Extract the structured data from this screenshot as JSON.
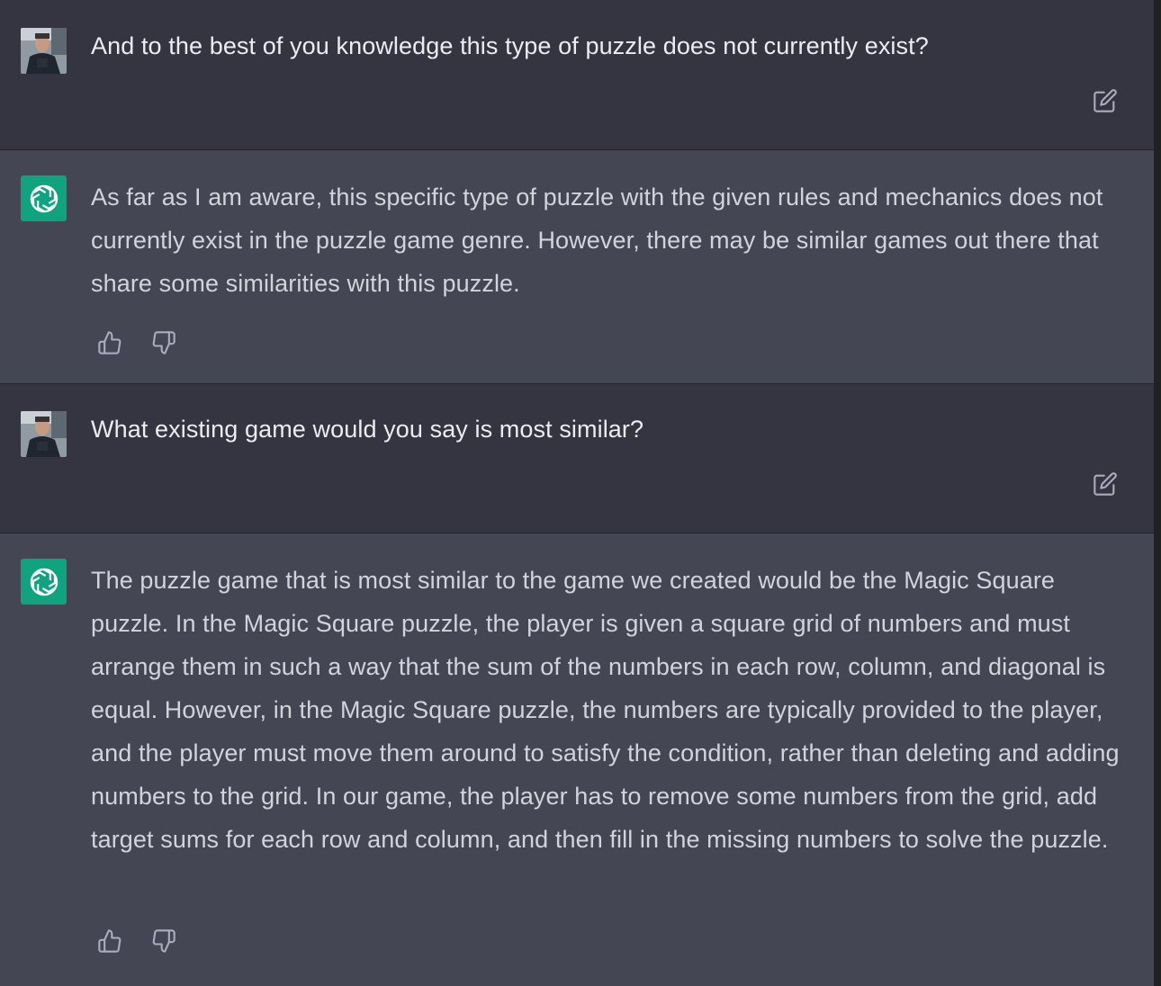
{
  "conversation": {
    "messages": [
      {
        "role": "user",
        "text": "And to the best of you knowledge this type of puzzle does not currently exist?",
        "avatar_icon": "user-avatar",
        "action_icon": "edit-icon"
      },
      {
        "role": "assistant",
        "text": "As far as I am aware, this specific type of puzzle with the given rules and mechanics does not currently exist in the puzzle game genre. However, there may be similar games out there that share some similarities with this puzzle.",
        "avatar_icon": "openai-logo-icon",
        "action_icons": [
          "thumbs-up-icon",
          "thumbs-down-icon"
        ]
      },
      {
        "role": "user",
        "text": "What existing game would you say is most similar?",
        "avatar_icon": "user-avatar",
        "action_icon": "edit-icon"
      },
      {
        "role": "assistant",
        "text": "The puzzle game that is most similar to the game we created would be the Magic Square puzzle. In the Magic Square puzzle, the player is given a square grid of numbers and must arrange them in such a way that the sum of the numbers in each row, column, and diagonal is equal. However, in the Magic Square puzzle, the numbers are typically provided to the player, and the player must move them around to satisfy the condition, rather than deleting and adding numbers to the grid. In our game, the player has to remove some numbers from the grid, add target sums for each row and column, and then fill in the missing numbers to solve the puzzle.",
        "avatar_icon": "openai-logo-icon",
        "action_icons": [
          "thumbs-up-icon",
          "thumbs-down-icon"
        ]
      }
    ]
  },
  "colors": {
    "user_bg": "#343541",
    "assistant_bg": "#444654",
    "assistant_avatar": "#10a37f",
    "user_text": "#ececf1",
    "assistant_text": "#d1d5db",
    "icon": "#acacbe"
  }
}
